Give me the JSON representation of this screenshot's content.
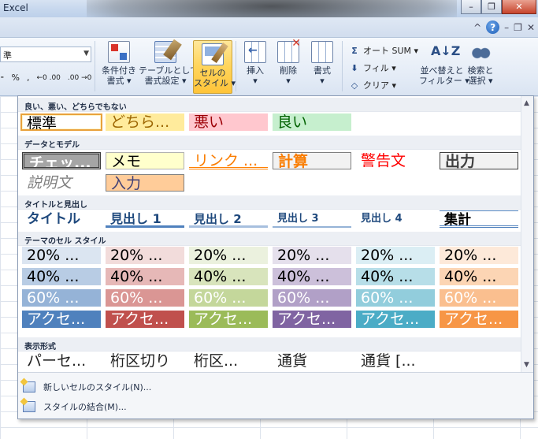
{
  "window": {
    "title": "Excel",
    "minimize": "–",
    "restore": "❐",
    "close": "✕"
  },
  "ribbon_top": {
    "minimize_ribbon": "^",
    "help": "?",
    "doc_minimize": "–",
    "doc_restore": "❐",
    "doc_close": "✕"
  },
  "ribbon": {
    "number_format": "準",
    "number_buttons": [
      "⁃",
      "%",
      ",",
      "←0 .00",
      ".00 →0"
    ],
    "conditional": "条件付き\n書式 ▾",
    "table": "テーブルとして\n書式設定 ▾",
    "cell_styles": "セルの\nスタイル ▾",
    "insert": "挿入\n▾",
    "delete": "削除\n▾",
    "format": "書式\n▾",
    "autosum": "オート SUM ▾",
    "fill": "フィル ▾",
    "clear": "クリア ▾",
    "sort": "並べ替えと\nフィルター ▾",
    "find": "検索と\n選択 ▾"
  },
  "colors": {
    "accent1": "#4f81bd",
    "accent2": "#c0504d",
    "accent3": "#9bbb59",
    "accent4": "#8064a2",
    "accent5": "#4bacc6",
    "accent6": "#f79646",
    "highlight_border": "#e9a23c"
  },
  "gallery": {
    "sec_good": "良い、悪い、どちらでもない",
    "sec_data": "データとモデル",
    "sec_title": "タイトルと見出し",
    "sec_theme": "テーマのセル スタイル",
    "sec_number": "表示形式",
    "good": {
      "normal": "標準",
      "neutral": "どちら...",
      "bad": "悪い",
      "good": "良い"
    },
    "data": {
      "check": "チェッ...",
      "memo": "メモ",
      "link": "リンク ...",
      "calc": "計算",
      "warn": "警告文",
      "output": "出力",
      "explain": "説明文",
      "input": "入力"
    },
    "titles": {
      "title": "タイトル",
      "h1": "見出し 1",
      "h2": "見出し 2",
      "h3": "見出し 3",
      "h4": "見出し 4",
      "total": "集計"
    },
    "theme_rows": [
      "20% ...",
      "40% ...",
      "60% ...",
      "アクセ..."
    ],
    "number": {
      "percent": "パーセ...",
      "comma": "桁区切り",
      "comma0": "桁区...",
      "currency": "通貨",
      "currency0": "通貨 [..."
    },
    "new_style": "新しいセルのスタイル(N)...",
    "merge": "スタイルの結合(M)..."
  }
}
